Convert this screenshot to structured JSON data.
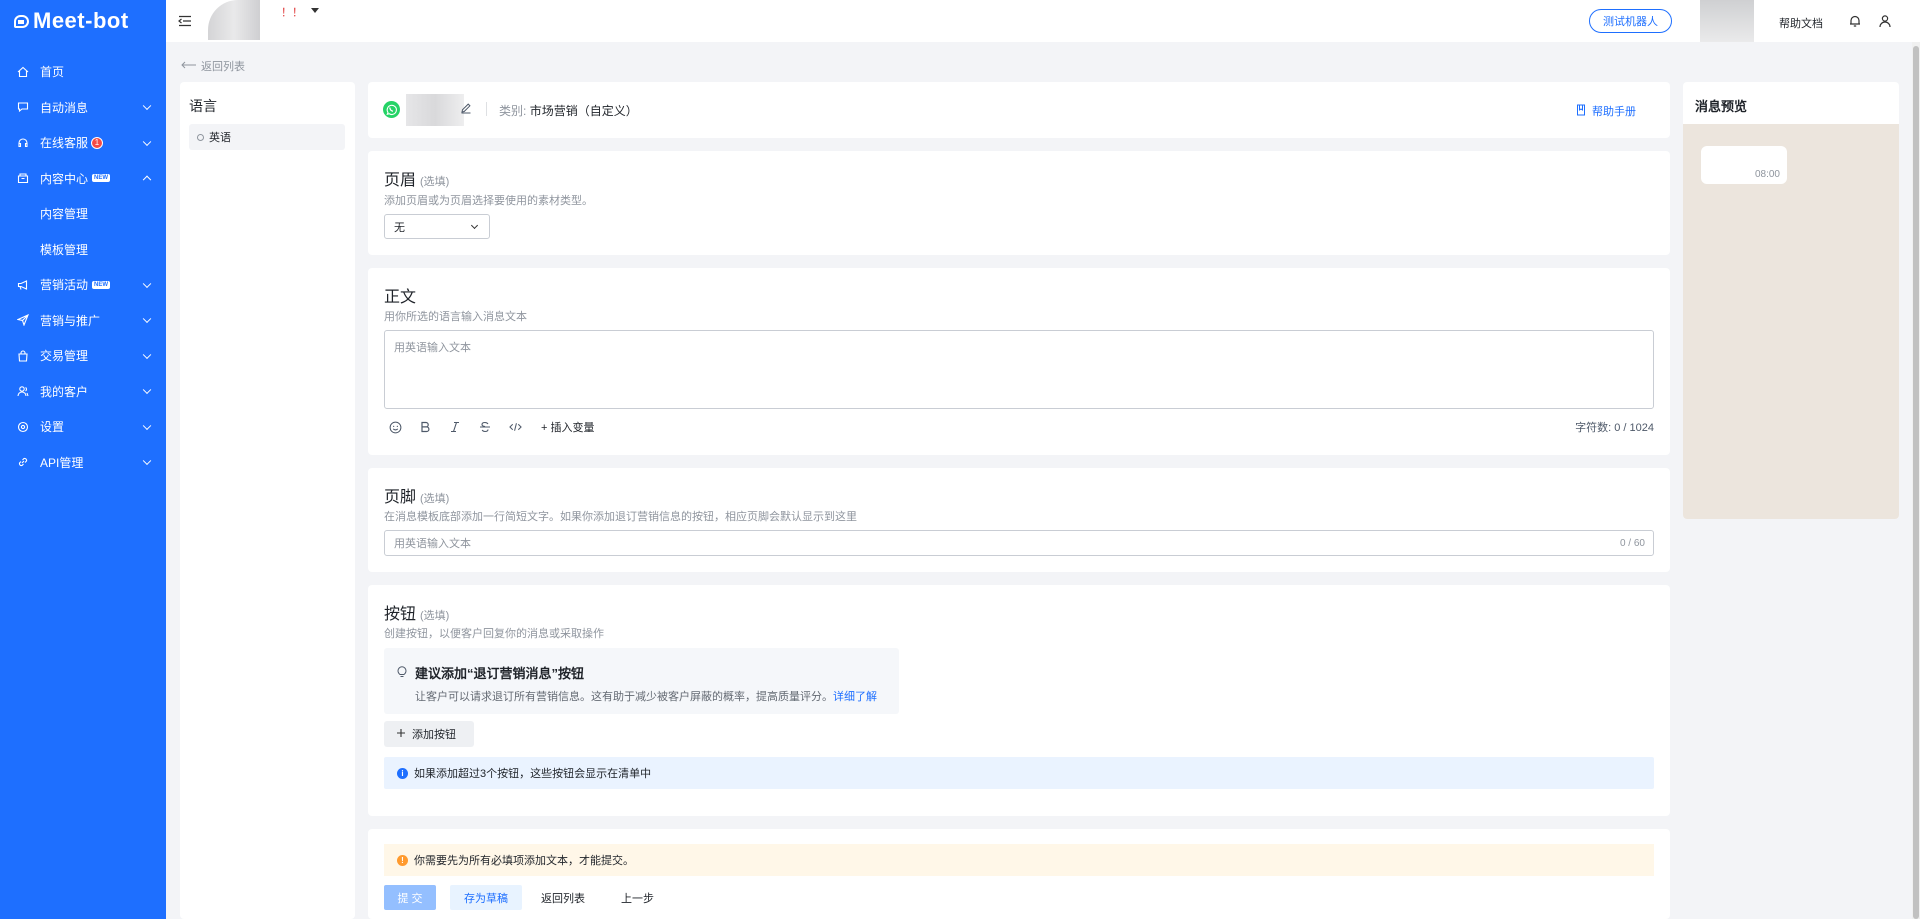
{
  "app": {
    "logo": "Meet-bot"
  },
  "sidebar": {
    "items": [
      {
        "label": "首页",
        "icon": "home-icon"
      },
      {
        "label": "自动消息",
        "icon": "chat-icon",
        "chevron": "down"
      },
      {
        "label": "在线客服",
        "icon": "headset-icon",
        "chevron": "down",
        "badge": "1"
      },
      {
        "label": "内容中心",
        "icon": "box-icon",
        "chevron": "up",
        "tag": "NEW"
      },
      {
        "label": "营销活动",
        "icon": "megaphone-icon",
        "chevron": "down",
        "tag": "NEW"
      },
      {
        "label": "营销与推广",
        "icon": "send-icon",
        "chevron": "down"
      },
      {
        "label": "交易管理",
        "icon": "bag-icon",
        "chevron": "down"
      },
      {
        "label": "我的客户",
        "icon": "users-icon",
        "chevron": "down"
      },
      {
        "label": "设置",
        "icon": "settings-icon",
        "chevron": "down"
      },
      {
        "label": "API管理",
        "icon": "link-icon",
        "chevron": "down"
      }
    ],
    "sub_items": [
      "内容管理",
      "模板管理"
    ]
  },
  "topbar": {
    "shop_name_suffix": "！！",
    "test_robot": "测试机器人",
    "help_doc": "帮助文档"
  },
  "back_link": "返回列表",
  "language": {
    "title": "语言",
    "items": [
      "英语"
    ]
  },
  "template_header": {
    "category_label": "类别:",
    "category_value": "市场营销（自定义）",
    "help_manual": "帮助手册"
  },
  "header_section": {
    "title": "页眉",
    "optional": "(选填)",
    "desc": "添加页眉或为页眉选择要使用的素材类型。",
    "select_value": "无"
  },
  "body_section": {
    "title": "正文",
    "desc": "用你所选的语言输入消息文本",
    "placeholder": "用英语输入文本",
    "insert_variable": "+ 插入变量",
    "char_count_label": "字符数:",
    "char_count": "0 / 1024"
  },
  "footer_section": {
    "title": "页脚",
    "optional": "(选填)",
    "desc": "在消息模板底部添加一行简短文字。如果你添加退订营销信息的按钮，相应页脚会默认显示到这里",
    "placeholder": "用英语输入文本",
    "count": "0 / 60"
  },
  "buttons_section": {
    "title": "按钮",
    "optional": "(选填)",
    "desc": "创建按钮，以便客户回复你的消息或采取操作",
    "suggest_title": "建议添加“退订营销消息”按钮",
    "suggest_text": "让客户可以请求退订所有营销信息。这有助于减少被客户屏蔽的概率，提高质量评分。",
    "learn_more": "详细了解",
    "add_button": "添加按钮",
    "info": "如果添加超过3个按钮，这些按钮会显示在清单中"
  },
  "submit_section": {
    "warning": "你需要先为所有必填项添加文本，才能提交。",
    "submit": "提 交",
    "save_draft": "存为草稿",
    "back_to_list": "返回列表",
    "previous": "上一步"
  },
  "preview": {
    "title": "消息预览",
    "time": "08:00"
  }
}
